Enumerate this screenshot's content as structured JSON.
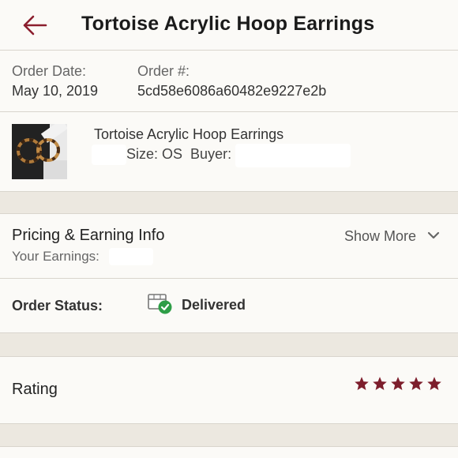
{
  "header": {
    "title": "Tortoise Acrylic Hoop Earrings",
    "back_icon": "back-arrow-icon",
    "accent": "#8b1e2e"
  },
  "order": {
    "date_label": "Order Date:",
    "date_value": "May 10, 2019",
    "number_label": "Order #:",
    "number_value": "5cd58e6086a60482e9227e2b"
  },
  "product": {
    "name": "Tortoise Acrylic Hoop Earrings",
    "size_label": "Size: OS",
    "buyer_label": "Buyer:"
  },
  "pricing": {
    "title": "Pricing & Earning Info",
    "earnings_label": "Your Earnings:",
    "show_more": "Show More"
  },
  "status": {
    "label": "Order Status:",
    "value": "Delivered",
    "icon": "delivered-box-icon",
    "check_color": "#2e9e47"
  },
  "rating": {
    "label": "Rating",
    "stars": 5,
    "max_stars": 5,
    "star_color": "#7d1e2c"
  }
}
